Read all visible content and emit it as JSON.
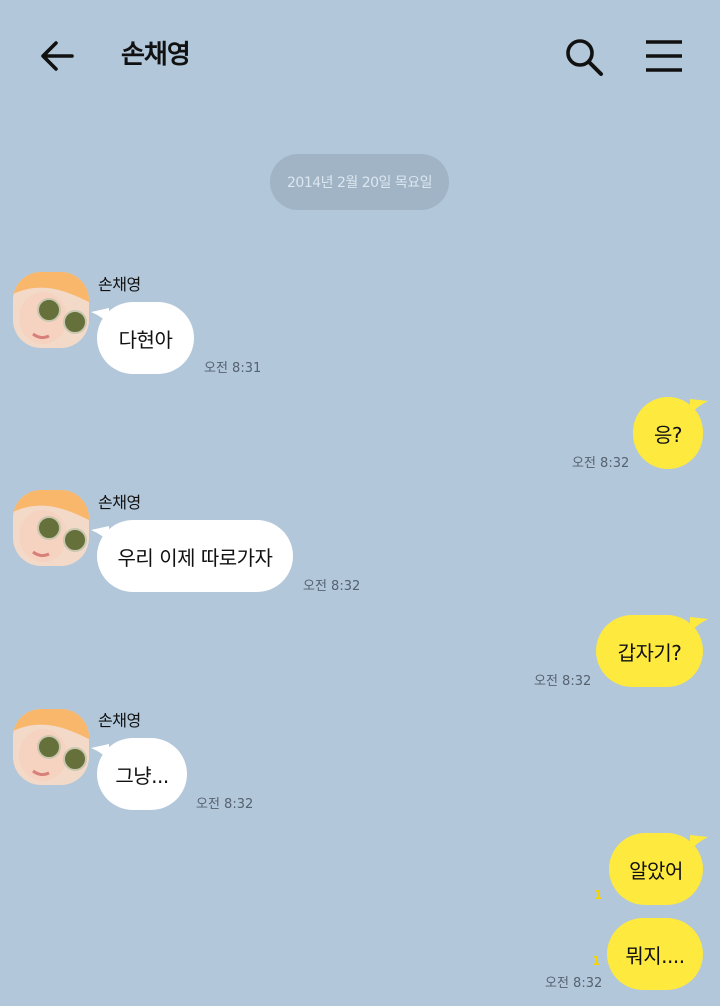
{
  "header": {
    "title": "손채영",
    "back_icon": "arrow-left-icon",
    "search_icon": "search-icon",
    "menu_icon": "hamburger-menu-icon"
  },
  "date_divider": "2014년 2월 20일 목요일",
  "colors": {
    "background": "#b2c7da",
    "incoming_bubble": "#ffffff",
    "outgoing_bubble": "#fee93e",
    "unread_count": "#f4d300"
  },
  "messages": [
    {
      "direction": "in",
      "sender": "손채영",
      "text": "다현아",
      "time": "오전 8:31"
    },
    {
      "direction": "out",
      "text": "응?",
      "time": "오전 8:32"
    },
    {
      "direction": "in",
      "sender": "손채영",
      "text": "우리 이제 따로가자",
      "time": "오전 8:32"
    },
    {
      "direction": "out",
      "text": "갑자기?",
      "time": "오전 8:32"
    },
    {
      "direction": "in",
      "sender": "손채영",
      "text": "그냥...",
      "time": "오전 8:32"
    },
    {
      "direction": "out",
      "text": "알았어",
      "unread": "1"
    },
    {
      "direction": "out",
      "text": "뭐지....",
      "unread": "1",
      "time": "오전 8:32"
    }
  ]
}
